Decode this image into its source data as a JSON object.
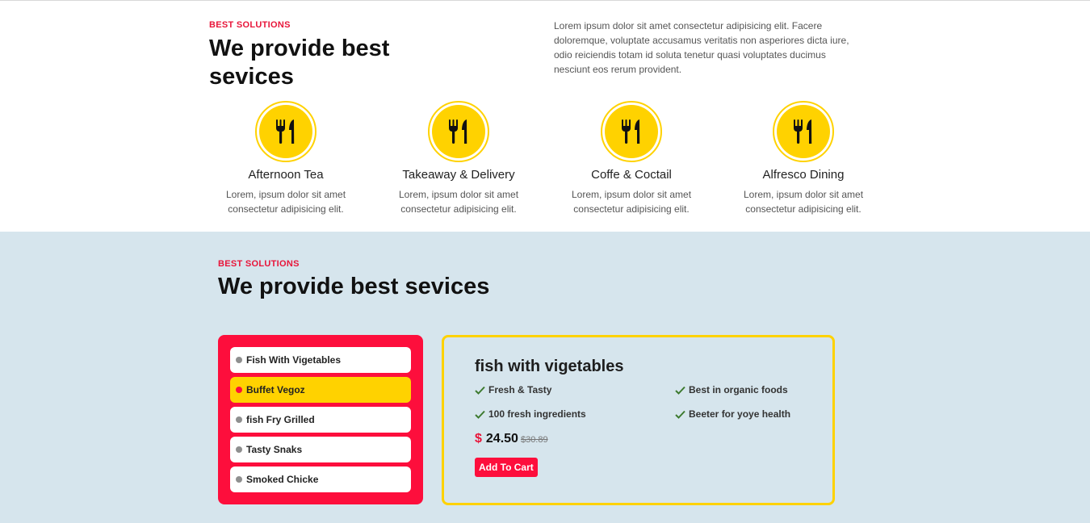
{
  "services": {
    "eyebrow": "BEST SOLUTIONS",
    "title": "We provide best sevices",
    "description": "Lorem ipsum dolor sit amet consectetur adipisicing elit. Facere doloremque, voluptate accusamus veritatis non asperiores dicta iure, odio reiciendis totam id soluta tenetur quasi voluptates ducimus nesciunt eos rerum provident.",
    "items": [
      {
        "icon": "fork-knife-icon",
        "title": "Afternoon Tea",
        "text": "Lorem, ipsum dolor sit amet consectetur adipisicing elit."
      },
      {
        "icon": "fork-knife-icon",
        "title": "Takeaway & Delivery",
        "text": "Lorem, ipsum dolor sit amet consectetur adipisicing elit."
      },
      {
        "icon": "fork-knife-icon",
        "title": "Coffe & Coctail",
        "text": "Lorem, ipsum dolor sit amet consectetur adipisicing elit."
      },
      {
        "icon": "fork-knife-icon",
        "title": "Alfresco Dining",
        "text": "Lorem, ipsum dolor sit amet consectetur adipisicing elit."
      }
    ]
  },
  "menu": {
    "eyebrow": "BEST SOLUTIONS",
    "title": "We provide best sevices",
    "items": [
      {
        "label": "Fish With Vigetables",
        "active": false
      },
      {
        "label": "Buffet Vegoz",
        "active": true
      },
      {
        "label": "fish Fry Grilled",
        "active": false
      },
      {
        "label": "Tasty Snaks",
        "active": false
      },
      {
        "label": "Smoked Chicke",
        "active": false
      }
    ]
  },
  "detail": {
    "title": "fish with vigetables",
    "features": [
      "Fresh & Tasty",
      "Best in organic foods",
      "100 fresh ingredients",
      "Beeter for yoye health"
    ],
    "currency": "$",
    "price": "24.50",
    "old_price": "$30.89",
    "cart_label": "Add To Cart"
  },
  "colors": {
    "accent_red": "#fd0e3c",
    "accent_yellow": "#ffd200",
    "section_bg": "#d6e5ed",
    "check_green": "#3d7a2f"
  }
}
